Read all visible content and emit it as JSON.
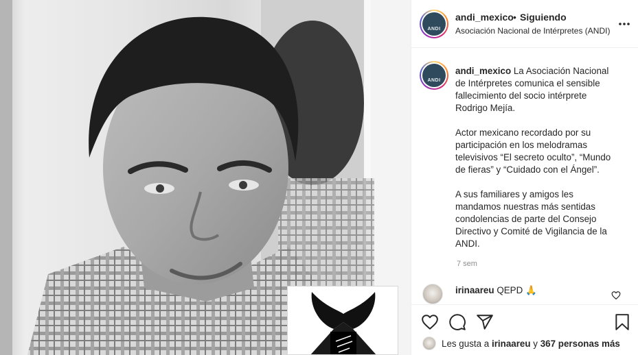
{
  "post": {
    "username": "andi_mexico",
    "dot": "•",
    "follow_status": "Siguiendo",
    "location": "Asociación Nacional de Intérpretes (ANDI)",
    "avatar_text": "ANDI"
  },
  "caption": {
    "username": "andi_mexico",
    "paragraph_1": "La Asociación Nacional de Intérpretes comunica el sensible fallecimiento del socio intérprete Rodrigo Mejía.",
    "paragraph_2": "Actor mexicano recordado por su participación en los melodramas televisivos “El secreto oculto”, “Mundo de fieras” y “Cuidado con el Ángel”.",
    "paragraph_3": "A sus familiares y amigos les mandamos nuestras más sentidas condolencias de parte del Consejo Directivo y Comité de Vigilancia de la ANDI.",
    "time_ago": "7 sem"
  },
  "comment": {
    "username": "irinaareu",
    "text": "QEPD 🙏"
  },
  "likes": {
    "prefix": "Les gusta a",
    "user": "irinaareu",
    "conj": "y",
    "others": "367 personas más"
  },
  "icons": {
    "more": "more-options-icon",
    "like": "heart-icon",
    "comment": "comment-icon",
    "share": "share-icon",
    "save": "bookmark-icon",
    "comment_like": "small-heart-icon"
  }
}
